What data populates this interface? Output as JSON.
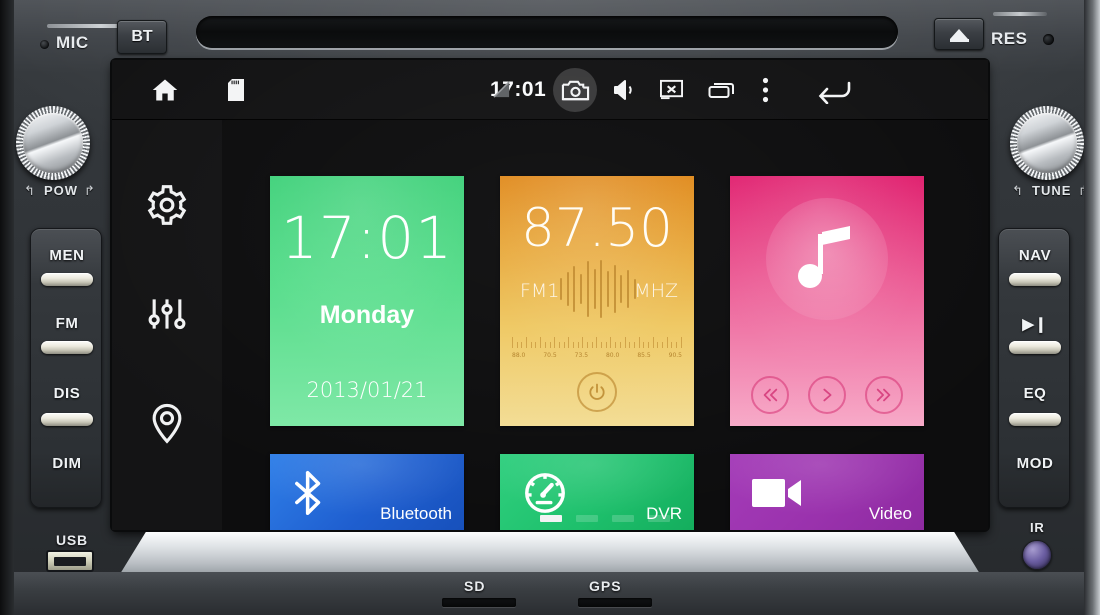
{
  "device": {
    "mic_label": "MIC",
    "bt_button": "BT",
    "res_label": "RES",
    "pow_knob_label": "POW",
    "tune_knob_label": "TUNE",
    "usb_label": "USB",
    "ir_label": "IR",
    "sd_slot_label": "SD",
    "gps_slot_label": "GPS",
    "left_buttons": [
      "MEN",
      "FM",
      "DIS",
      "DIM"
    ],
    "right_buttons": [
      "NAV",
      "▶❙",
      "EQ",
      "MOD"
    ]
  },
  "statusbar": {
    "home_icon": "home-icon",
    "sd_icon": "sd-card-icon",
    "signal_icon": "signal-off-icon",
    "time": "17:01",
    "camera_icon": "camera-icon",
    "volume_icon": "volume-icon",
    "close_screen_icon": "screen-off-icon",
    "recents_icon": "recent-apps-icon",
    "overflow_icon": "overflow-menu-icon",
    "back_icon": "back-arrow-icon"
  },
  "rail": {
    "items": [
      {
        "name": "settings",
        "icon": "gear-icon"
      },
      {
        "name": "equalizer",
        "icon": "sliders-icon"
      },
      {
        "name": "navigation",
        "icon": "location-pin-icon"
      }
    ]
  },
  "tiles": {
    "clock": {
      "time": "17:01",
      "weekday": "Monday",
      "date": "2013/01/21",
      "color": "#4dd889"
    },
    "radio": {
      "frequency": "87.50",
      "band": "FM1",
      "unit": "MHZ",
      "power_icon": "power-icon",
      "scale_ticks": [
        "88.0",
        "70.5",
        "73.5",
        "80.0",
        "85.5",
        "90.5"
      ],
      "color": "#e8a93c"
    },
    "music": {
      "icon": "music-note-icon",
      "prev_icon": "previous-track-icon",
      "play_icon": "play-icon",
      "next_icon": "next-track-icon",
      "color": "#ec5c95"
    },
    "bluetooth": {
      "label": "Bluetooth",
      "icon": "bluetooth-icon",
      "color": "#1f5fd0"
    },
    "dvr": {
      "label": "DVR",
      "icon": "speedometer-icon",
      "color": "#1ec06c"
    },
    "video": {
      "label": "Video",
      "icon": "video-camera-icon",
      "color": "#9a32ad"
    }
  },
  "pager": {
    "pages": 4,
    "active": 1
  }
}
